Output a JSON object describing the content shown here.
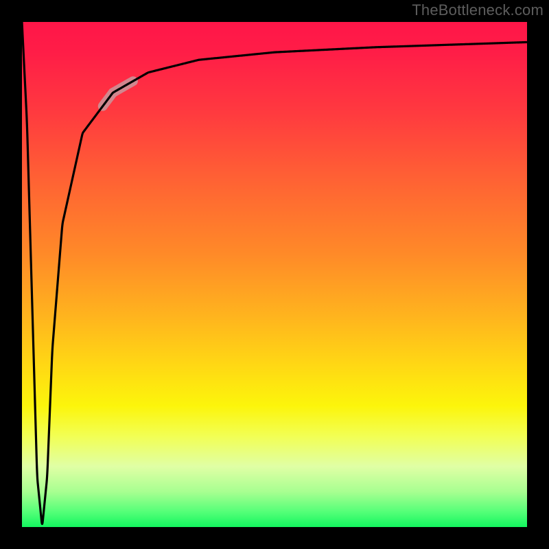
{
  "watermark": "TheBottleneck.com",
  "colors": {
    "frame_bg": "#000000",
    "curve": "#000000",
    "highlight": "rgba(196,160,164,0.78)",
    "gradient_top": "#ff1648",
    "gradient_mid1": "#ff8a28",
    "gradient_mid2": "#fcf50b",
    "gradient_bottom": "#13f65f"
  },
  "chart_data": {
    "type": "line",
    "x": [
      0,
      1,
      3,
      4,
      5,
      6,
      8,
      12,
      18,
      25,
      35,
      50,
      70,
      100
    ],
    "values": [
      100,
      80,
      10,
      0,
      10,
      35,
      60,
      78,
      86,
      90,
      92.5,
      94,
      95,
      96
    ],
    "title": "",
    "xlabel": "",
    "ylabel": "",
    "xlim": [
      0,
      100
    ],
    "ylim": [
      0,
      100
    ],
    "highlight_range_x": [
      16,
      22
    ],
    "notes": "Black curve on red→green vertical gradient. Curve drops from y≈100 at x=0 to y≈0 at x≈4, then rises asymptotically toward y≈96 by x=100. A thick semi-transparent gray-pink segment highlights the curve roughly over x∈[16,22]."
  }
}
